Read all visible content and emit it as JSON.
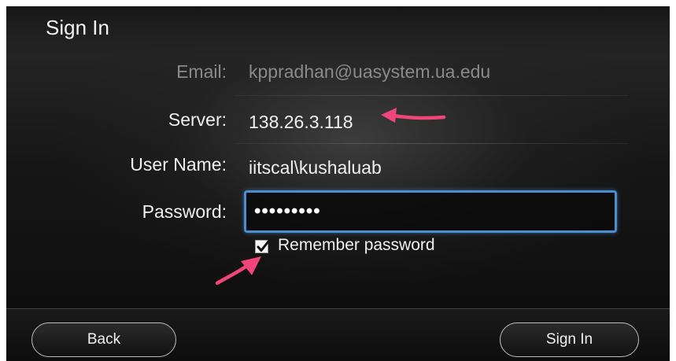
{
  "header": {
    "title": "Sign In"
  },
  "form": {
    "email_label": "Email:",
    "email_value": "kppradhan@uasystem.ua.edu",
    "server_label": "Server:",
    "server_value": "138.26.3.118",
    "username_label": "User Name:",
    "username_value": "iitscal\\kushaluab",
    "password_label": "Password:",
    "password_value": "•••••••••",
    "remember_label": "Remember password",
    "remember_checked": true
  },
  "footer": {
    "back_label": "Back",
    "signin_label": "Sign In"
  },
  "colors": {
    "focus_border": "#4a8ed1",
    "annotation_arrow": "#f0457a"
  },
  "icons": {
    "checkmark": "checkmark-icon",
    "annotation": "annotation-arrow-icon"
  }
}
